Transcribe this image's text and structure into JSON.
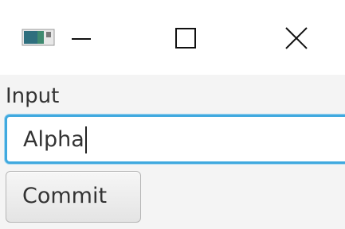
{
  "window": {
    "controls": {
      "minimize_icon": "minimize-icon",
      "maximize_icon": "maximize-icon",
      "close_icon": "close-icon"
    }
  },
  "form": {
    "input_label": "Input",
    "input_value": "Alpha",
    "commit_label": "Commit"
  },
  "colors": {
    "focus_border": "#40a9df",
    "background": "#f4f4f4",
    "titlebar": "#ffffff",
    "text": "#333333"
  }
}
